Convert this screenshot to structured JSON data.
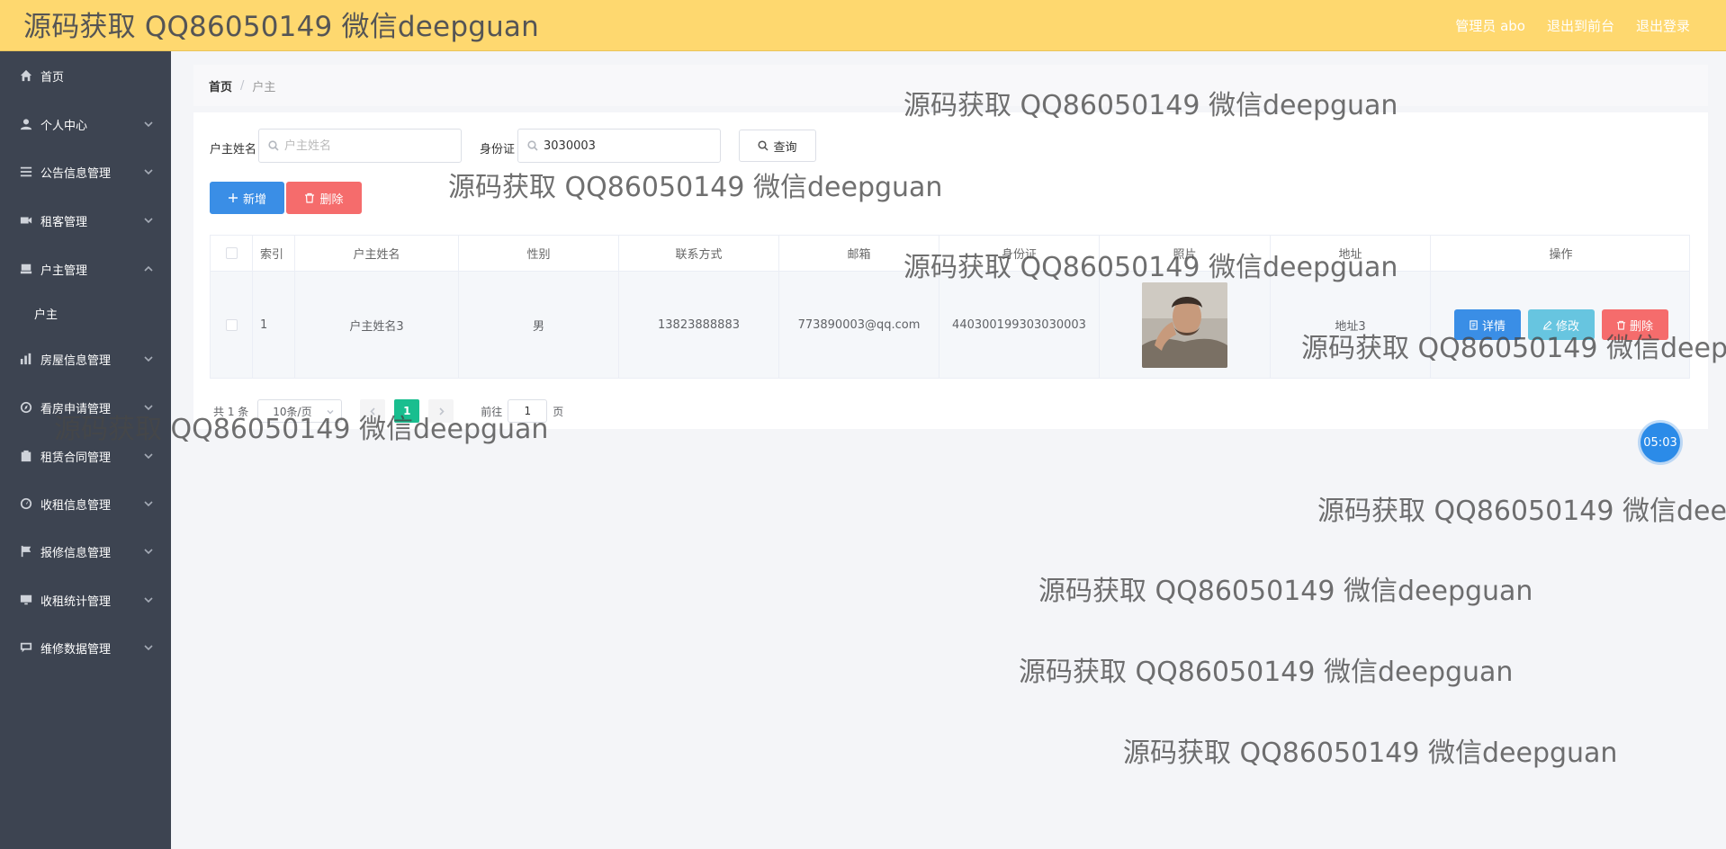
{
  "header": {
    "brand": "源码获取 QQ86050149 微信deepguan",
    "admin": "管理员 abo",
    "back_to_front": "退出到前台",
    "logout": "退出登录"
  },
  "sidebar": {
    "items": [
      {
        "label": "首页",
        "icon": "home-icon"
      },
      {
        "label": "个人中心",
        "icon": "user-icon"
      },
      {
        "label": "公告信息管理",
        "icon": "list-icon"
      },
      {
        "label": "租客管理",
        "icon": "video-icon"
      },
      {
        "label": "户主管理",
        "icon": "tray-icon"
      },
      {
        "label": "户主",
        "icon": ""
      },
      {
        "label": "房屋信息管理",
        "icon": "bar-chart-icon"
      },
      {
        "label": "看房申请管理",
        "icon": "compass-icon"
      },
      {
        "label": "租赁合同管理",
        "icon": "clipboard-icon"
      },
      {
        "label": "收租信息管理",
        "icon": "gauge-icon"
      },
      {
        "label": "报修信息管理",
        "icon": "flag-icon"
      },
      {
        "label": "收租统计管理",
        "icon": "monitor-icon"
      },
      {
        "label": "维修数据管理",
        "icon": "chat-icon"
      }
    ]
  },
  "breadcrumb": {
    "home": "首页",
    "separator": "/",
    "current": "户主"
  },
  "search": {
    "name_label": "户主姓名",
    "name_placeholder": "户主姓名",
    "name_value": "",
    "id_label": "身份证",
    "id_value": "3030003",
    "query_button": "查询"
  },
  "actions": {
    "add": "新增",
    "delete": "删除"
  },
  "table": {
    "headers": [
      "索引",
      "户主姓名",
      "性别",
      "联系方式",
      "邮箱",
      "身份证",
      "照片",
      "地址",
      "操作"
    ],
    "rows": [
      {
        "index": "1",
        "name": "户主姓名3",
        "sex": "男",
        "phone": "13823888883",
        "email": "773890003@qq.com",
        "id_card": "440300199303030003",
        "address": "地址3"
      }
    ],
    "op_detail": "详情",
    "op_edit": "修改",
    "op_delete": "删除"
  },
  "pager": {
    "total": "共 1 条",
    "page_size": "10条/页",
    "current_page": "1",
    "goto_label": "前往",
    "goto_value": "1",
    "unit": "页"
  },
  "timer": "05:03",
  "watermark": "源码获取 QQ86050149 微信deepguan",
  "colors": {
    "header_bg": "#fed86f",
    "sidebar_bg": "#3d4451",
    "primary": "#3a8ee6",
    "danger": "#f56c6c",
    "info": "#67c5e0",
    "pager_active": "#19be8f"
  }
}
